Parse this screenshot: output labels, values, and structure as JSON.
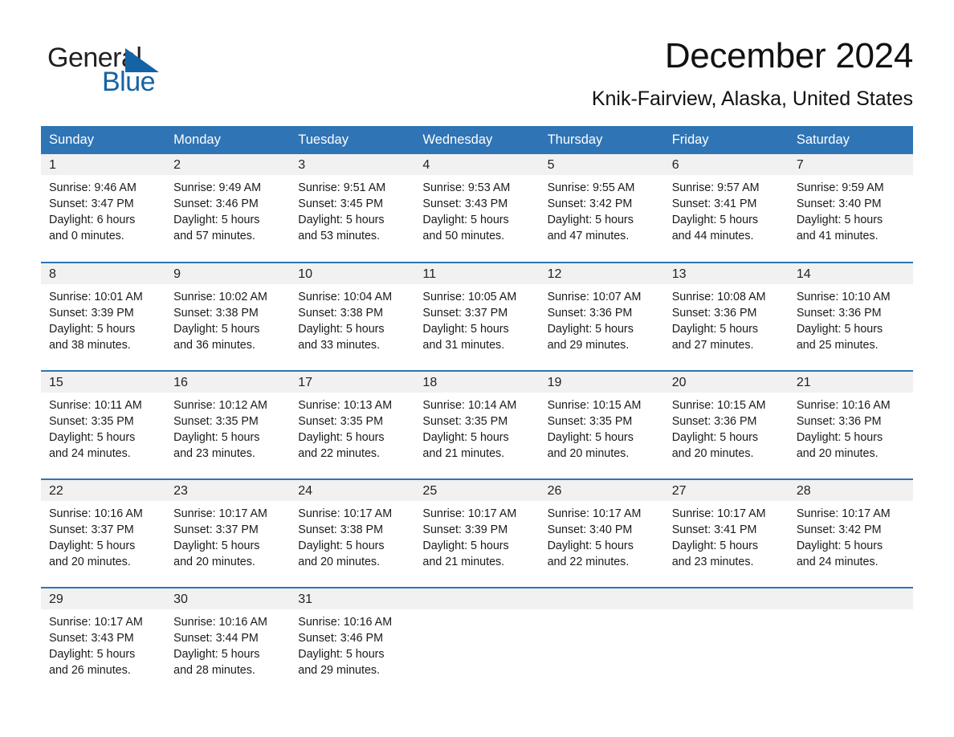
{
  "brand": {
    "name_part1": "General",
    "name_part2": "Blue",
    "triangle_icon": "triangle-icon",
    "accent_color": "#1464a5"
  },
  "header": {
    "title": "December 2024",
    "subtitle": "Knik-Fairview, Alaska, United States"
  },
  "theme": {
    "header_blue": "#2f74b5",
    "daynum_gray": "#f1f1f1",
    "text": "#1a1a1a"
  },
  "weekdays": [
    "Sunday",
    "Monday",
    "Tuesday",
    "Wednesday",
    "Thursday",
    "Friday",
    "Saturday"
  ],
  "weeks": [
    [
      {
        "day": "1",
        "sunrise": "Sunrise: 9:46 AM",
        "sunset": "Sunset: 3:47 PM",
        "daylight1": "Daylight: 6 hours",
        "daylight2": "and 0 minutes."
      },
      {
        "day": "2",
        "sunrise": "Sunrise: 9:49 AM",
        "sunset": "Sunset: 3:46 PM",
        "daylight1": "Daylight: 5 hours",
        "daylight2": "and 57 minutes."
      },
      {
        "day": "3",
        "sunrise": "Sunrise: 9:51 AM",
        "sunset": "Sunset: 3:45 PM",
        "daylight1": "Daylight: 5 hours",
        "daylight2": "and 53 minutes."
      },
      {
        "day": "4",
        "sunrise": "Sunrise: 9:53 AM",
        "sunset": "Sunset: 3:43 PM",
        "daylight1": "Daylight: 5 hours",
        "daylight2": "and 50 minutes."
      },
      {
        "day": "5",
        "sunrise": "Sunrise: 9:55 AM",
        "sunset": "Sunset: 3:42 PM",
        "daylight1": "Daylight: 5 hours",
        "daylight2": "and 47 minutes."
      },
      {
        "day": "6",
        "sunrise": "Sunrise: 9:57 AM",
        "sunset": "Sunset: 3:41 PM",
        "daylight1": "Daylight: 5 hours",
        "daylight2": "and 44 minutes."
      },
      {
        "day": "7",
        "sunrise": "Sunrise: 9:59 AM",
        "sunset": "Sunset: 3:40 PM",
        "daylight1": "Daylight: 5 hours",
        "daylight2": "and 41 minutes."
      }
    ],
    [
      {
        "day": "8",
        "sunrise": "Sunrise: 10:01 AM",
        "sunset": "Sunset: 3:39 PM",
        "daylight1": "Daylight: 5 hours",
        "daylight2": "and 38 minutes."
      },
      {
        "day": "9",
        "sunrise": "Sunrise: 10:02 AM",
        "sunset": "Sunset: 3:38 PM",
        "daylight1": "Daylight: 5 hours",
        "daylight2": "and 36 minutes."
      },
      {
        "day": "10",
        "sunrise": "Sunrise: 10:04 AM",
        "sunset": "Sunset: 3:38 PM",
        "daylight1": "Daylight: 5 hours",
        "daylight2": "and 33 minutes."
      },
      {
        "day": "11",
        "sunrise": "Sunrise: 10:05 AM",
        "sunset": "Sunset: 3:37 PM",
        "daylight1": "Daylight: 5 hours",
        "daylight2": "and 31 minutes."
      },
      {
        "day": "12",
        "sunrise": "Sunrise: 10:07 AM",
        "sunset": "Sunset: 3:36 PM",
        "daylight1": "Daylight: 5 hours",
        "daylight2": "and 29 minutes."
      },
      {
        "day": "13",
        "sunrise": "Sunrise: 10:08 AM",
        "sunset": "Sunset: 3:36 PM",
        "daylight1": "Daylight: 5 hours",
        "daylight2": "and 27 minutes."
      },
      {
        "day": "14",
        "sunrise": "Sunrise: 10:10 AM",
        "sunset": "Sunset: 3:36 PM",
        "daylight1": "Daylight: 5 hours",
        "daylight2": "and 25 minutes."
      }
    ],
    [
      {
        "day": "15",
        "sunrise": "Sunrise: 10:11 AM",
        "sunset": "Sunset: 3:35 PM",
        "daylight1": "Daylight: 5 hours",
        "daylight2": "and 24 minutes."
      },
      {
        "day": "16",
        "sunrise": "Sunrise: 10:12 AM",
        "sunset": "Sunset: 3:35 PM",
        "daylight1": "Daylight: 5 hours",
        "daylight2": "and 23 minutes."
      },
      {
        "day": "17",
        "sunrise": "Sunrise: 10:13 AM",
        "sunset": "Sunset: 3:35 PM",
        "daylight1": "Daylight: 5 hours",
        "daylight2": "and 22 minutes."
      },
      {
        "day": "18",
        "sunrise": "Sunrise: 10:14 AM",
        "sunset": "Sunset: 3:35 PM",
        "daylight1": "Daylight: 5 hours",
        "daylight2": "and 21 minutes."
      },
      {
        "day": "19",
        "sunrise": "Sunrise: 10:15 AM",
        "sunset": "Sunset: 3:35 PM",
        "daylight1": "Daylight: 5 hours",
        "daylight2": "and 20 minutes."
      },
      {
        "day": "20",
        "sunrise": "Sunrise: 10:15 AM",
        "sunset": "Sunset: 3:36 PM",
        "daylight1": "Daylight: 5 hours",
        "daylight2": "and 20 minutes."
      },
      {
        "day": "21",
        "sunrise": "Sunrise: 10:16 AM",
        "sunset": "Sunset: 3:36 PM",
        "daylight1": "Daylight: 5 hours",
        "daylight2": "and 20 minutes."
      }
    ],
    [
      {
        "day": "22",
        "sunrise": "Sunrise: 10:16 AM",
        "sunset": "Sunset: 3:37 PM",
        "daylight1": "Daylight: 5 hours",
        "daylight2": "and 20 minutes."
      },
      {
        "day": "23",
        "sunrise": "Sunrise: 10:17 AM",
        "sunset": "Sunset: 3:37 PM",
        "daylight1": "Daylight: 5 hours",
        "daylight2": "and 20 minutes."
      },
      {
        "day": "24",
        "sunrise": "Sunrise: 10:17 AM",
        "sunset": "Sunset: 3:38 PM",
        "daylight1": "Daylight: 5 hours",
        "daylight2": "and 20 minutes."
      },
      {
        "day": "25",
        "sunrise": "Sunrise: 10:17 AM",
        "sunset": "Sunset: 3:39 PM",
        "daylight1": "Daylight: 5 hours",
        "daylight2": "and 21 minutes."
      },
      {
        "day": "26",
        "sunrise": "Sunrise: 10:17 AM",
        "sunset": "Sunset: 3:40 PM",
        "daylight1": "Daylight: 5 hours",
        "daylight2": "and 22 minutes."
      },
      {
        "day": "27",
        "sunrise": "Sunrise: 10:17 AM",
        "sunset": "Sunset: 3:41 PM",
        "daylight1": "Daylight: 5 hours",
        "daylight2": "and 23 minutes."
      },
      {
        "day": "28",
        "sunrise": "Sunrise: 10:17 AM",
        "sunset": "Sunset: 3:42 PM",
        "daylight1": "Daylight: 5 hours",
        "daylight2": "and 24 minutes."
      }
    ],
    [
      {
        "day": "29",
        "sunrise": "Sunrise: 10:17 AM",
        "sunset": "Sunset: 3:43 PM",
        "daylight1": "Daylight: 5 hours",
        "daylight2": "and 26 minutes."
      },
      {
        "day": "30",
        "sunrise": "Sunrise: 10:16 AM",
        "sunset": "Sunset: 3:44 PM",
        "daylight1": "Daylight: 5 hours",
        "daylight2": "and 28 minutes."
      },
      {
        "day": "31",
        "sunrise": "Sunrise: 10:16 AM",
        "sunset": "Sunset: 3:46 PM",
        "daylight1": "Daylight: 5 hours",
        "daylight2": "and 29 minutes."
      },
      {
        "day": "",
        "sunrise": "",
        "sunset": "",
        "daylight1": "",
        "daylight2": ""
      },
      {
        "day": "",
        "sunrise": "",
        "sunset": "",
        "daylight1": "",
        "daylight2": ""
      },
      {
        "day": "",
        "sunrise": "",
        "sunset": "",
        "daylight1": "",
        "daylight2": ""
      },
      {
        "day": "",
        "sunrise": "",
        "sunset": "",
        "daylight1": "",
        "daylight2": ""
      }
    ]
  ]
}
